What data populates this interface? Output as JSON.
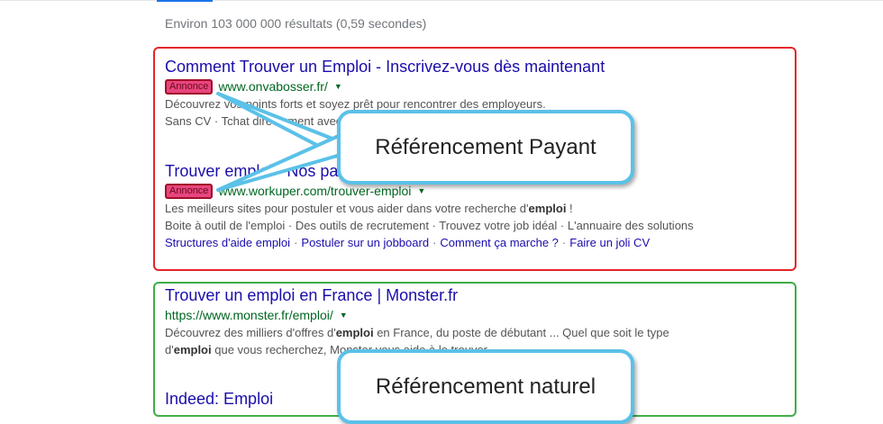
{
  "stats_text": "Environ 103 000 000 résultats (0,59 secondes)",
  "results": [
    {
      "title": "Comment Trouver un Emploi - Inscrivez-vous dès maintenant",
      "badge": "Annonce",
      "url": "www.onvabosser.fr/",
      "snippet1": "Découvrez vos points forts et soyez prêt pour rencontrer des employeurs.",
      "snippet2": "Sans CV · Tchat directement avec les recruteurs · Sans lettre de motivation"
    },
    {
      "title": "Trouver emploi - Nos partenaires vous aident sur Workuper.com",
      "badge": "Annonce",
      "url": "www.workuper.com/trouver-emploi",
      "snippet1_pre": "Les meilleurs sites pour postuler et vous aider dans votre recherche d'",
      "snippet1_bold": "emploi",
      "snippet1_post": " !",
      "snippet2": "Boite à outil de l'emploi · Des outils de recrutement · Trouvez votre job idéal · L'annuaire des solutions",
      "sitelinks": [
        "Structures d'aide emploi",
        "Postuler sur un jobboard",
        "Comment ça marche ?",
        "Faire un joli CV"
      ],
      "sitelink_sep": "·"
    },
    {
      "title": "Trouver un emploi en France | Monster.fr",
      "url": "https://www.monster.fr/emploi/",
      "snippet1_pre": "Découvrez des milliers d'offres d'",
      "snippet1_bold": "emploi",
      "snippet1_post": " en France, du poste de débutant ... Quel que soit le type",
      "snippet2_pre": "d'",
      "snippet2_bold": "emploi",
      "snippet2_post": " que vous recherchez, Monster vous aide à le trouver."
    },
    {
      "title": "Indeed: Emploi"
    }
  ],
  "callouts": {
    "paid": "Référencement Payant",
    "organic": "Référencement naturel"
  },
  "colors": {
    "paid_box": "#e3262b",
    "organic_box": "#3fae49",
    "callout_border": "#5bc1e8",
    "link": "#1a0dab",
    "url": "#006621",
    "badge_fill": "#e8457e"
  },
  "icons": {
    "url_menu": "caret-down-icon"
  }
}
